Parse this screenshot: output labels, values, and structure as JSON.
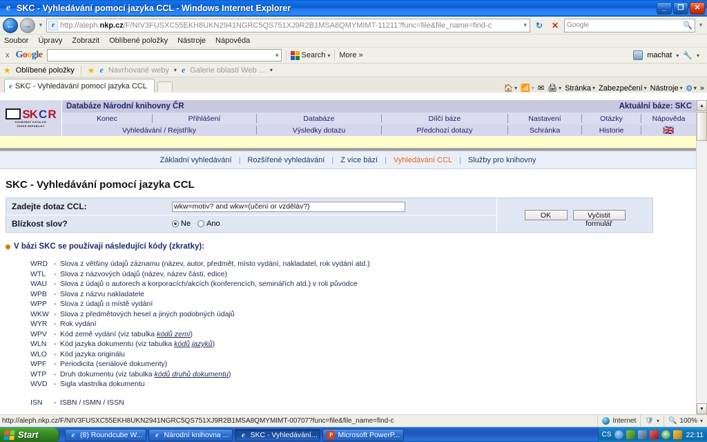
{
  "window": {
    "title": "SKC - Vyhledávání pomocí jazyka CCL - Windows Internet Explorer",
    "minimize_label": "_",
    "maximize_label": "❐",
    "close_label": "✕"
  },
  "address_bar": {
    "url_prefix": "http://aleph.",
    "url_domain": "nkp.cz",
    "url_rest": "/F/NIV3FUSXC55EKH8UKN2941NGRC5QS751XJ9R2B1MSA8QMYMIMT-11211?func=file&file_name=find-c",
    "dropdown_icon": "chevron-down-icon",
    "refresh_icon": "↻",
    "stop_icon": "✕",
    "search_placeholder": "Google",
    "go_icon": "→"
  },
  "menu_bar": {
    "items": [
      "Soubor",
      "Úpravy",
      "Zobrazit",
      "Oblíbené položky",
      "Nástroje",
      "Nápověda"
    ]
  },
  "google_toolbar": {
    "close_label": "x",
    "logo_letters": [
      {
        "c": "G",
        "cls": "b"
      },
      {
        "c": "o",
        "cls": "r"
      },
      {
        "c": "o",
        "cls": "y"
      },
      {
        "c": "g",
        "cls": "b"
      },
      {
        "c": "l",
        "cls": "g"
      },
      {
        "c": "e",
        "cls": "r"
      }
    ],
    "search_value": "",
    "search_button": "Search",
    "more_button": "More »",
    "account_name": "machat",
    "settings_icon": "wrench-icon"
  },
  "favorites_bar": {
    "favorites_label": "Oblíbené položky",
    "suggested_sites": "Navrhované weby",
    "web_slice_gallery": "Galerie oblastí Web ..."
  },
  "tabs": {
    "items": [
      {
        "label": "SKC - Vyhledávání pomocí jazyka CCL",
        "active": true
      }
    ],
    "new_tab_label": ""
  },
  "command_bar": {
    "home_icon": "home-icon",
    "feeds_icon": "rss-icon",
    "read_mail_icon": "mail-icon",
    "print_icon": "printer-icon",
    "page_label": "Stránka",
    "safety_label": "Zabezpečení",
    "tools_label": "Nástroje",
    "help_label": "?",
    "overflow_label": "»"
  },
  "site": {
    "logo": {
      "sk": "SK",
      "c": "C",
      "r": "R",
      "sub_line1": "SOUBORNÝ KATALOG",
      "sub_line2": "ČESKÉ REPUBLIKY"
    },
    "header_title": "Databáze Národní knihovny ČR",
    "current_base_label": "Aktuální báze:  SKC",
    "nav_row1": [
      "Konec",
      "Přihlášení",
      "Databáze",
      "Dílčí báze",
      "Nastavení",
      "Otázky",
      "Nápověda"
    ],
    "nav_row2": [
      "Vyhledávání / Rejstříky",
      "Výsledky dotazu",
      "Předchozí dotazy",
      "Schránka",
      "Historie",
      "🇬🇧"
    ],
    "subnav": [
      {
        "label": "Základní vyhledávání",
        "active": false
      },
      {
        "label": "Rozšířené vyhledávání",
        "active": false
      },
      {
        "label": "Z více bází",
        "active": false
      },
      {
        "label": "Vyhledávání CCL",
        "active": true
      },
      {
        "label": "Služby pro knihovny",
        "active": false
      }
    ]
  },
  "main": {
    "page_title": "SKC - Vyhledávání pomocí jazyka CCL",
    "form": {
      "query_label": "Zadejte dotaz CCL:",
      "query_value": "wkw=motiv? and wkw=(učení or vzdělàv?)",
      "proximity_label": "Blízkost slov?",
      "radio_no": "Ne",
      "radio_yes": "Ano",
      "radio_selected": "Ne",
      "ok_button": "OK",
      "clear_button": "Vyčistit formulář"
    },
    "codes_heading": "V bázi SKC se používají následující kódy (zkratky):",
    "codes": [
      {
        "key": "WRD",
        "desc": "Slova z většiny údajů záznamu (název, autor, předmět, místo vydání, nakladatel, rok vydání atd.)"
      },
      {
        "key": "WTL",
        "desc": "Slova z názvových údajů (název, název části, edice)"
      },
      {
        "key": "WAU",
        "desc": "Slova z údajů o autorech a korporacích/akcích (konferencích, seminářích atd.) v roli původce"
      },
      {
        "key": "WPB",
        "desc": "Slova z názvu nakladatele"
      },
      {
        "key": "WPP",
        "desc": "Slova z údajů o místě vydání"
      },
      {
        "key": "WKW",
        "desc": "Slova z předmětových hesel a jiných podobných údajů"
      },
      {
        "key": "WYR",
        "desc": "Rok vydání"
      },
      {
        "key": "WPV",
        "desc": "Kód země vydání (viz tabulka ",
        "link": "kódů zemí",
        "desc_after": ")"
      },
      {
        "key": "WLN",
        "desc": "Kód jazyka dokumentu (viz tabulka ",
        "link": "kódů jazyků",
        "desc_after": ")"
      },
      {
        "key": "WLO",
        "desc": "Kód jazyka originálu"
      },
      {
        "key": "WPF",
        "desc": "Periodicita (seriálové dokumenty)"
      },
      {
        "key": "WTP",
        "desc": "Druh dokumentu (viz tabulka ",
        "link": "kódů druhů dokumentu",
        "desc_after": ")"
      },
      {
        "key": "WVD",
        "desc": "Sigla vlastníka dokumentu"
      }
    ],
    "codes_extra": [
      {
        "key": "ISN",
        "desc": "ISBN / ISMN / ISSN"
      }
    ]
  },
  "status_bar": {
    "url": "http://aleph.nkp.cz/F/NIV3FUSXC55EKH8UKN2941NGRC5QS751XJ9R2B1MSA8QMYMIMT-00707?func=file&file_name=find-c",
    "zone": "Internet",
    "zoom": "100%"
  },
  "taskbar": {
    "start_label": "Start",
    "items": [
      {
        "label": "(8) Roundcube W...",
        "icon": "ie-icon",
        "active": false
      },
      {
        "label": "Národní knihovna ...",
        "icon": "ie-icon",
        "active": false
      },
      {
        "label": "SKC - Vyhledávání...",
        "icon": "ie-icon",
        "active": true
      },
      {
        "label": "Microsoft PowerP...",
        "icon": "powerpoint-icon",
        "active": false
      }
    ],
    "language": "CS",
    "clock": "22:11"
  }
}
